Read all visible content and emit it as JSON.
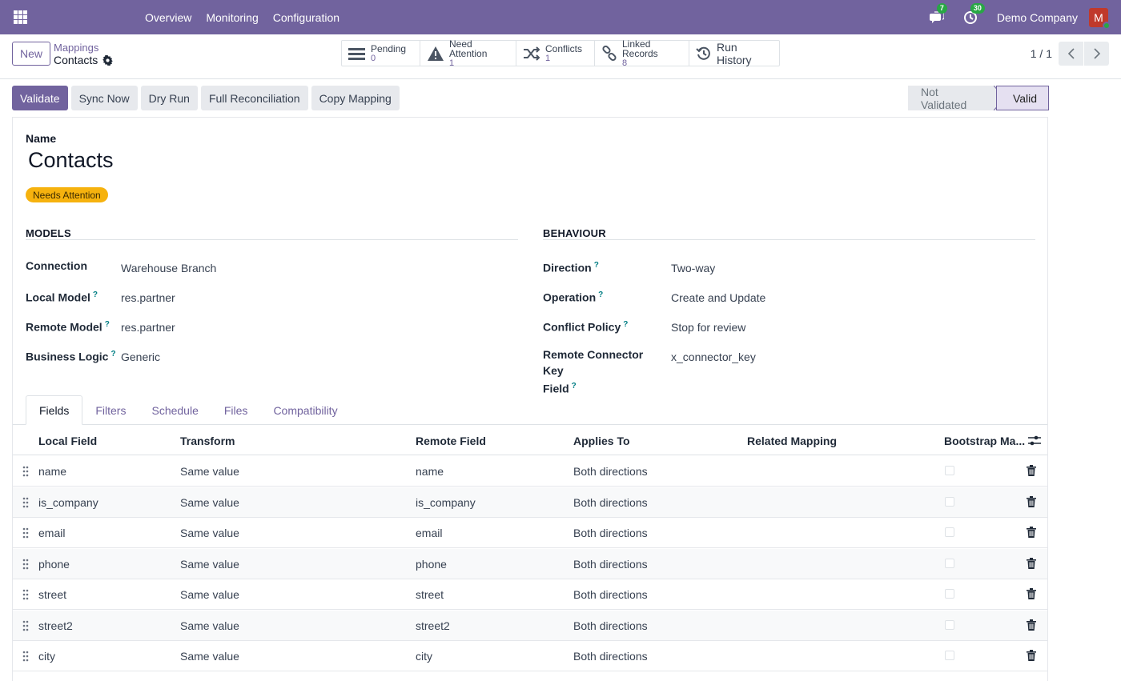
{
  "navbar": {
    "menu": [
      "Overview",
      "Monitoring",
      "Configuration"
    ],
    "messages_count": "7",
    "activities_count": "30",
    "company": "Demo Company",
    "avatar_initial": "M"
  },
  "control_panel": {
    "new_label": "New",
    "breadcrumb_parent": "Mappings",
    "breadcrumb_current": "Contacts",
    "smart_buttons": [
      {
        "label": "Pending",
        "value": "0",
        "icon": "list-icon"
      },
      {
        "label": "Need Attention",
        "value": "1",
        "icon": "warning-icon"
      },
      {
        "label": "Conflicts",
        "value": "1",
        "icon": "shuffle-icon"
      },
      {
        "label": "Linked Records",
        "value": "8",
        "icon": "link-icon"
      },
      {
        "label": "Run History",
        "icon": "history-icon"
      }
    ],
    "pager": "1 / 1"
  },
  "actions": {
    "validate": "Validate",
    "sync_now": "Sync Now",
    "dry_run": "Dry Run",
    "full_reconciliation": "Full Reconciliation",
    "copy_mapping": "Copy Mapping"
  },
  "status": {
    "steps": [
      "Not Validated",
      "Valid"
    ],
    "current": "Valid"
  },
  "record": {
    "name_label": "Name",
    "name": "Contacts",
    "badge": "Needs Attention",
    "badge_color": "#f6b20e"
  },
  "models": {
    "title": "MODELS",
    "fields": [
      {
        "label": "Connection",
        "value": "Warehouse Branch",
        "help": false
      },
      {
        "label": "Local Model",
        "value": "res.partner",
        "help": true
      },
      {
        "label": "Remote Model",
        "value": "res.partner",
        "help": true
      },
      {
        "label": "Business Logic",
        "value": "Generic",
        "help": true
      }
    ]
  },
  "behaviour": {
    "title": "BEHAVIOUR",
    "fields": [
      {
        "label": "Direction",
        "value": "Two-way",
        "help": true
      },
      {
        "label": "Operation",
        "value": "Create and Update",
        "help": true
      },
      {
        "label": "Conflict Policy",
        "value": "Stop for review",
        "help": true
      },
      {
        "label": "Remote Connector Key",
        "label2": "Field",
        "value": "x_connector_key",
        "help": true
      }
    ]
  },
  "tabs": [
    "Fields",
    "Filters",
    "Schedule",
    "Files",
    "Compatibility"
  ],
  "help_mark": "?",
  "table": {
    "columns": [
      "Local Field",
      "Transform",
      "Remote Field",
      "Applies To",
      "Related Mapping",
      "Bootstrap Ma..."
    ],
    "rows": [
      {
        "local": "name",
        "transform": "Same value",
        "remote": "name",
        "applies": "Both directions",
        "related": ""
      },
      {
        "local": "is_company",
        "transform": "Same value",
        "remote": "is_company",
        "applies": "Both directions",
        "related": ""
      },
      {
        "local": "email",
        "transform": "Same value",
        "remote": "email",
        "applies": "Both directions",
        "related": ""
      },
      {
        "local": "phone",
        "transform": "Same value",
        "remote": "phone",
        "applies": "Both directions",
        "related": ""
      },
      {
        "local": "street",
        "transform": "Same value",
        "remote": "street",
        "applies": "Both directions",
        "related": ""
      },
      {
        "local": "street2",
        "transform": "Same value",
        "remote": "street2",
        "applies": "Both directions",
        "related": ""
      },
      {
        "local": "city",
        "transform": "Same value",
        "remote": "city",
        "applies": "Both directions",
        "related": ""
      }
    ]
  },
  "colors": {
    "brand": "#71639e",
    "help": "#017e84",
    "badge_green": "#28a745"
  }
}
